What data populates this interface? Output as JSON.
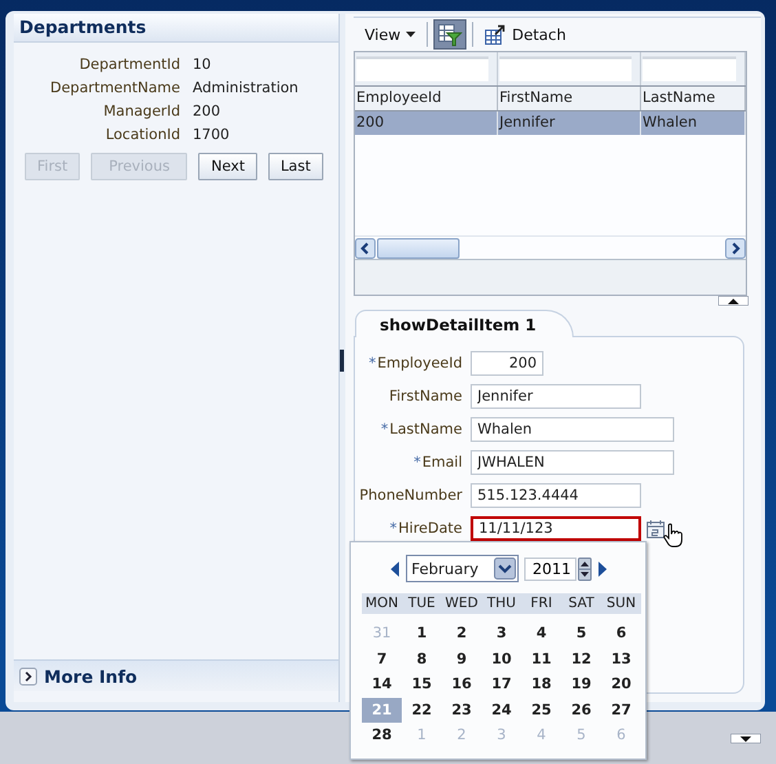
{
  "departments": {
    "title": "Departments",
    "fields": [
      {
        "label": "DepartmentId",
        "value": "10"
      },
      {
        "label": "DepartmentName",
        "value": "Administration"
      },
      {
        "label": "ManagerId",
        "value": "200"
      },
      {
        "label": "LocationId",
        "value": "1700"
      }
    ],
    "buttons": [
      {
        "label": "First",
        "disabled": true
      },
      {
        "label": "Previous",
        "disabled": true
      },
      {
        "label": "Next",
        "disabled": false
      },
      {
        "label": "Last",
        "disabled": false
      }
    ]
  },
  "more_info": {
    "label": "More Info",
    "expanded": false
  },
  "toolbar": {
    "view_label": "View",
    "filter_on": true,
    "detach_label": "Detach"
  },
  "table": {
    "columns": [
      "EmployeeId",
      "FirstName",
      "LastName"
    ],
    "rows": [
      {
        "cells": [
          "200",
          "Jennifer",
          "Whalen"
        ],
        "selected": true
      }
    ]
  },
  "detail_tab": {
    "label": "showDetailItem 1"
  },
  "form": {
    "required_mark": "*",
    "fields": [
      {
        "label": "EmployeeId",
        "required": true,
        "value": "200",
        "invalid": false
      },
      {
        "label": "FirstName",
        "required": false,
        "value": "Jennifer",
        "invalid": false
      },
      {
        "label": "LastName",
        "required": true,
        "value": "Whalen",
        "invalid": false
      },
      {
        "label": "Email",
        "required": true,
        "value": "JWHALEN",
        "invalid": false
      },
      {
        "label": "PhoneNumber",
        "required": false,
        "value": "515.123.4444",
        "invalid": false
      },
      {
        "label": "HireDate",
        "required": true,
        "value": "11/11/123",
        "invalid": true
      }
    ]
  },
  "calendar": {
    "month": "February",
    "year": "2011",
    "weekdays": [
      "MON",
      "TUE",
      "WED",
      "THU",
      "FRI",
      "SAT",
      "SUN"
    ],
    "weeks": [
      [
        {
          "day": "31",
          "outside": true,
          "selected": false
        },
        {
          "day": "1",
          "outside": false,
          "selected": false
        },
        {
          "day": "2",
          "outside": false,
          "selected": false
        },
        {
          "day": "3",
          "outside": false,
          "selected": false
        },
        {
          "day": "4",
          "outside": false,
          "selected": false
        },
        {
          "day": "5",
          "outside": false,
          "selected": false
        },
        {
          "day": "6",
          "outside": false,
          "selected": false
        }
      ],
      [
        {
          "day": "7",
          "outside": false,
          "selected": false
        },
        {
          "day": "8",
          "outside": false,
          "selected": false
        },
        {
          "day": "9",
          "outside": false,
          "selected": false
        },
        {
          "day": "10",
          "outside": false,
          "selected": false
        },
        {
          "day": "11",
          "outside": false,
          "selected": false
        },
        {
          "day": "12",
          "outside": false,
          "selected": false
        },
        {
          "day": "13",
          "outside": false,
          "selected": false
        }
      ],
      [
        {
          "day": "14",
          "outside": false,
          "selected": false
        },
        {
          "day": "15",
          "outside": false,
          "selected": false
        },
        {
          "day": "16",
          "outside": false,
          "selected": false
        },
        {
          "day": "17",
          "outside": false,
          "selected": false
        },
        {
          "day": "18",
          "outside": false,
          "selected": false
        },
        {
          "day": "19",
          "outside": false,
          "selected": false
        },
        {
          "day": "20",
          "outside": false,
          "selected": false
        }
      ],
      [
        {
          "day": "21",
          "outside": false,
          "selected": true
        },
        {
          "day": "22",
          "outside": false,
          "selected": false
        },
        {
          "day": "23",
          "outside": false,
          "selected": false
        },
        {
          "day": "24",
          "outside": false,
          "selected": false
        },
        {
          "day": "25",
          "outside": false,
          "selected": false
        },
        {
          "day": "26",
          "outside": false,
          "selected": false
        },
        {
          "day": "27",
          "outside": false,
          "selected": false
        }
      ],
      [
        {
          "day": "28",
          "outside": false,
          "selected": false
        },
        {
          "day": "1",
          "outside": true,
          "selected": false
        },
        {
          "day": "2",
          "outside": true,
          "selected": false
        },
        {
          "day": "3",
          "outside": true,
          "selected": false
        },
        {
          "day": "4",
          "outside": true,
          "selected": false
        },
        {
          "day": "5",
          "outside": true,
          "selected": false
        },
        {
          "day": "6",
          "outside": true,
          "selected": false
        }
      ]
    ]
  }
}
